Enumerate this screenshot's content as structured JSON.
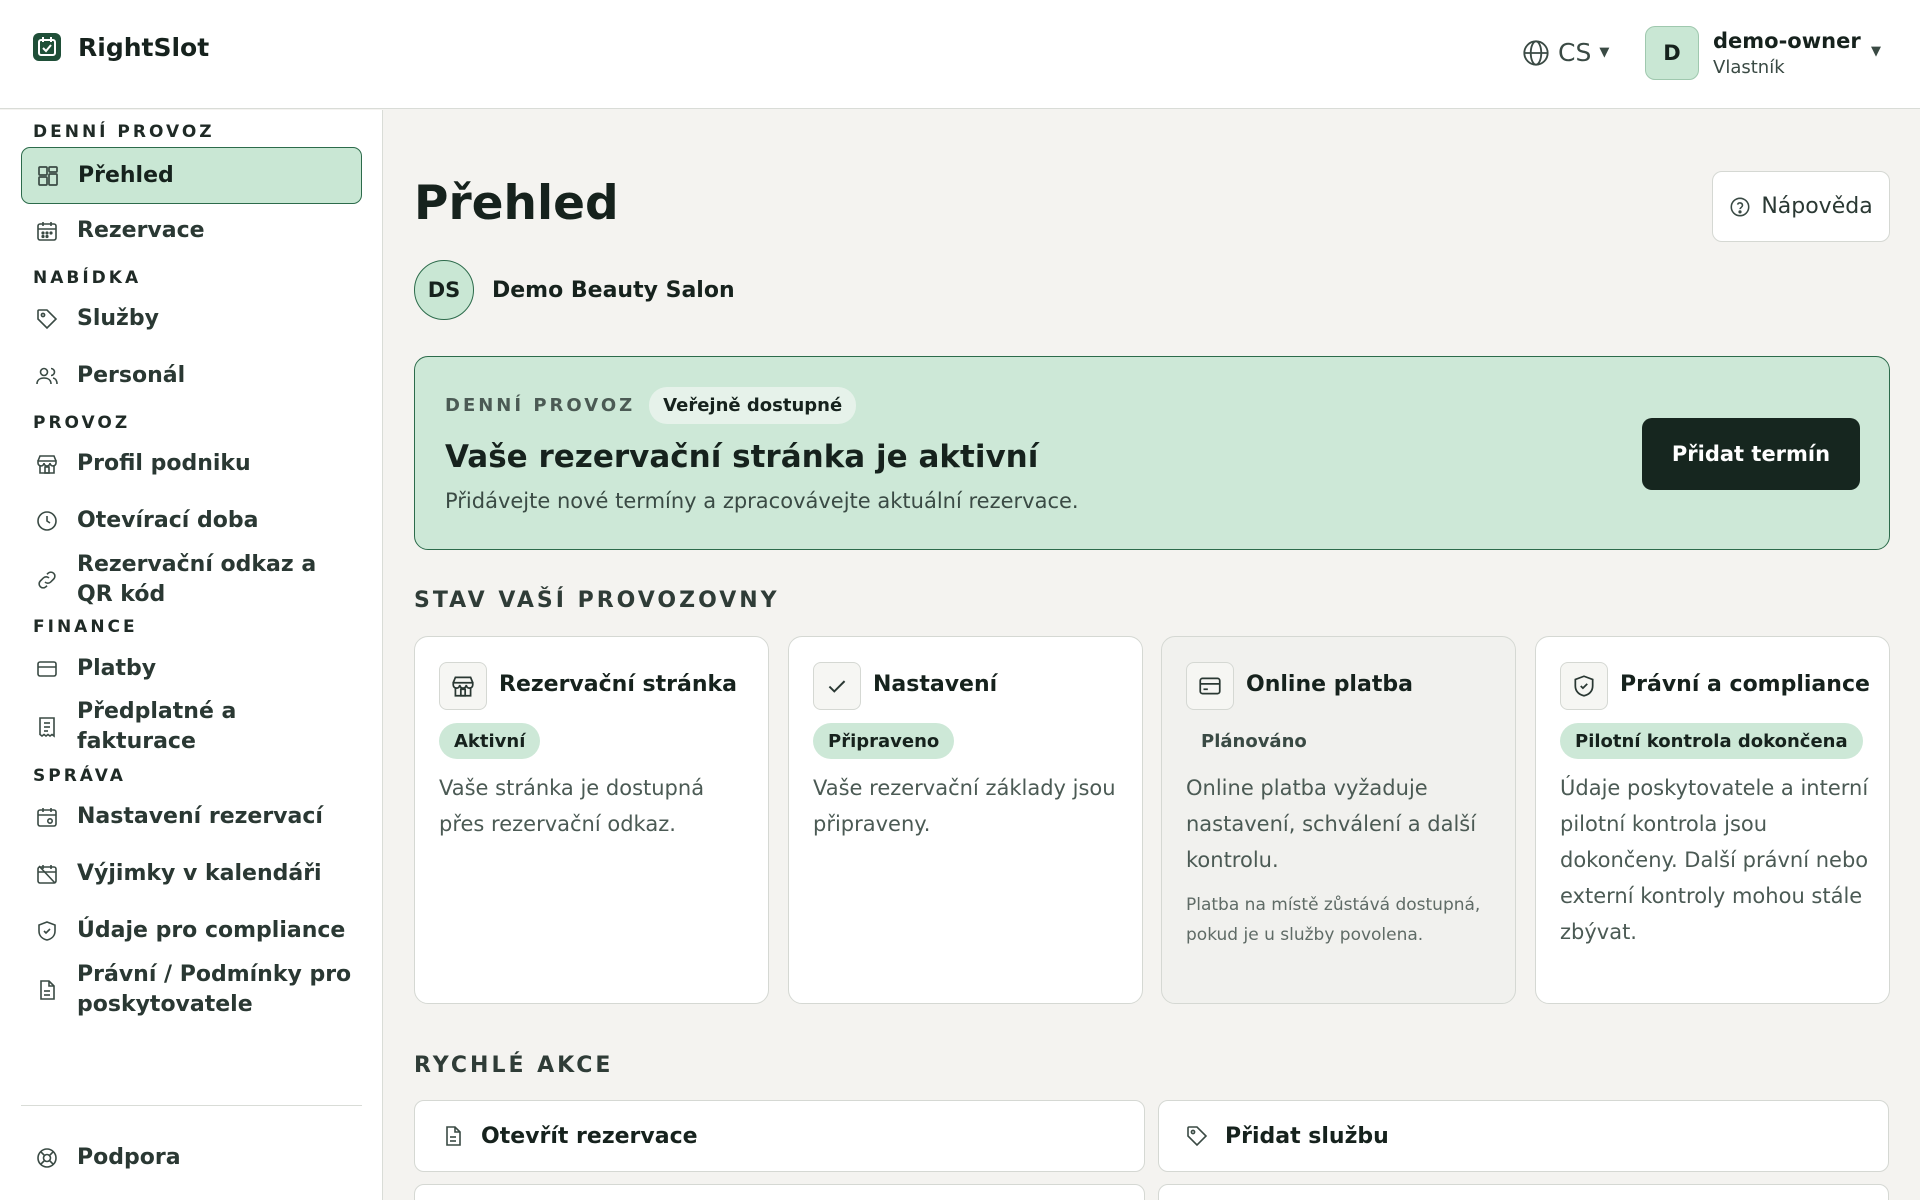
{
  "header": {
    "brand": "RightSlot",
    "lang": "CS",
    "user": {
      "initial": "D",
      "name": "demo-owner",
      "role": "Vlastník"
    }
  },
  "sidebar": {
    "sections": [
      "DENNÍ PROVOZ",
      "NABÍDKA",
      "PROVOZ",
      "FINANCE",
      "SPRÁVA"
    ],
    "items": [
      {
        "label": "Přehled",
        "icon": "dashboard-icon"
      },
      {
        "label": "Rezervace",
        "icon": "calendar-icon"
      },
      {
        "label": "Služby",
        "icon": "tag-icon"
      },
      {
        "label": "Personál",
        "icon": "users-icon"
      },
      {
        "label": "Profil podniku",
        "icon": "store-icon"
      },
      {
        "label": "Otevírací doba",
        "icon": "clock-icon"
      },
      {
        "label": "Rezervační odkaz a QR kód",
        "icon": "link-icon"
      },
      {
        "label": "Platby",
        "icon": "card-icon"
      },
      {
        "label": "Předplatné a fakturace",
        "icon": "receipt-icon"
      },
      {
        "label": "Nastavení rezervací",
        "icon": "calendar-settings-icon"
      },
      {
        "label": "Výjimky v kalendáři",
        "icon": "calendar-off-icon"
      },
      {
        "label": "Údaje pro compliance",
        "icon": "shield-icon"
      },
      {
        "label": "Právní / Podmínky pro poskytovatele",
        "icon": "document-icon"
      }
    ],
    "support": "Podpora"
  },
  "main": {
    "title": "Přehled",
    "help": "Nápověda",
    "business": {
      "initials": "DS",
      "name": "Demo Beauty Salon"
    },
    "hero": {
      "eyebrow": "DENNÍ PROVOZ",
      "pill": "Veřejně dostupné",
      "title": "Vaše rezervační stránka je aktivní",
      "subtitle": "Přidávejte nové termíny a zpracovávejte aktuální rezervace.",
      "button": "Přidat termín"
    },
    "status_heading": "STAV VAŠÍ PROVOZOVNY",
    "cards": [
      {
        "title": "Rezervační stránka",
        "badge": "Aktivní",
        "desc": "Vaše stránka je dostupná přes rezervační odkaz."
      },
      {
        "title": "Nastavení",
        "badge": "Připraveno",
        "desc": "Vaše rezervační základy jsou připraveny."
      },
      {
        "title": "Online platba",
        "badge": "Plánováno",
        "desc": "Online platba vyžaduje nastavení, schválení a další kontrolu.",
        "note": "Platba na místě zůstává dostupná, pokud je u služby povolena."
      },
      {
        "title": "Právní a compliance",
        "badge": "Pilotní kontrola dokončena",
        "desc": "Údaje poskytovatele a interní pilotní kontrola jsou dokončeny. Další právní nebo externí kontroly mohou stále zbývat."
      }
    ],
    "quick_heading": "RYCHLÉ AKCE",
    "quick": [
      {
        "label": "Otevřít rezervace"
      },
      {
        "label": "Přidat službu"
      }
    ]
  },
  "colors": {
    "accent_bg": "#c9e7d4",
    "accent_border": "#2c6b4b",
    "primary_button": "#16261f",
    "page_bg": "#f4f3f0"
  }
}
